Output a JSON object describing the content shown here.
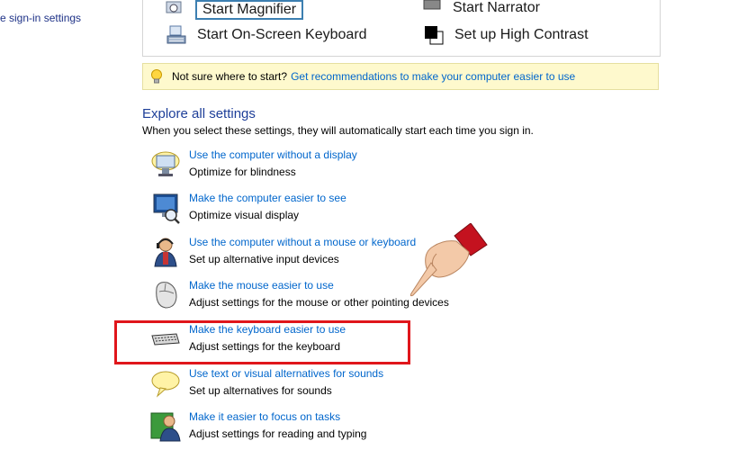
{
  "sidebar": {
    "signin_link": "e sign-in settings"
  },
  "quick_access": {
    "items": [
      {
        "label": "Start Magnifier",
        "icon": "magnifier-icon"
      },
      {
        "label": "Start Narrator",
        "icon": "narrator-icon"
      },
      {
        "label": "Start On-Screen Keyboard",
        "icon": "onscreen-keyboard-icon"
      },
      {
        "label": "Set up High Contrast",
        "icon": "high-contrast-icon"
      }
    ]
  },
  "tip": {
    "text": "Not sure where to start?",
    "link": "Get recommendations to make your computer easier to use",
    "icon": "lightbulb-icon"
  },
  "explore": {
    "title": "Explore all settings",
    "description": "When you select these settings, they will automatically start each time you sign in.",
    "items": [
      {
        "link": "Use the computer without a display",
        "desc": "Optimize for blindness",
        "icon": "no-display-icon"
      },
      {
        "link": "Make the computer easier to see",
        "desc": "Optimize visual display",
        "icon": "monitor-magnifier-icon"
      },
      {
        "link": "Use the computer without a mouse or keyboard",
        "desc": "Set up alternative input devices",
        "icon": "headset-user-icon"
      },
      {
        "link": "Make the mouse easier to use",
        "desc": "Adjust settings for the mouse or other pointing devices",
        "icon": "mouse-icon"
      },
      {
        "link": "Make the keyboard easier to use",
        "desc": "Adjust settings for the keyboard",
        "icon": "keyboard-icon"
      },
      {
        "link": "Use text or visual alternatives for sounds",
        "desc": "Set up alternatives for sounds",
        "icon": "speech-bubble-icon"
      },
      {
        "link": "Make it easier to focus on tasks",
        "desc": "Adjust settings for reading and typing",
        "icon": "focus-user-icon"
      }
    ]
  },
  "annotation": {
    "highlight_color": "#e0161b",
    "pointer_icon": "pointing-hand-icon"
  }
}
